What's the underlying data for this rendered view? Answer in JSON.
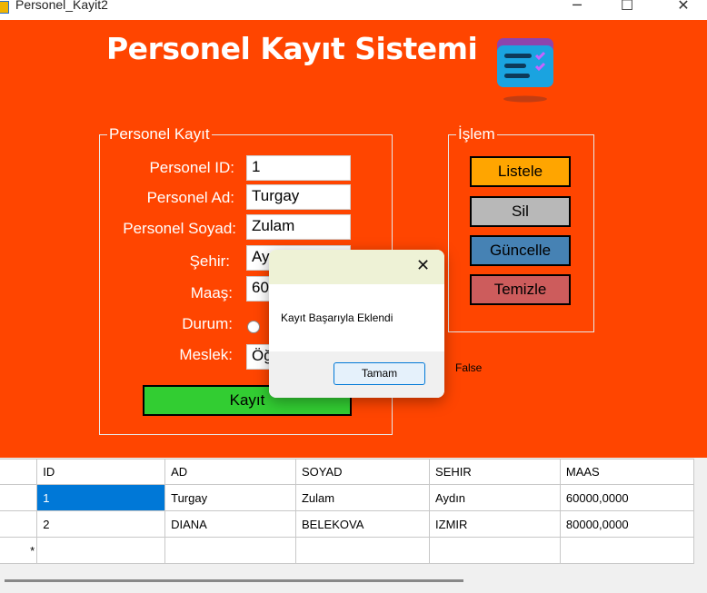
{
  "window": {
    "title": "Personel_Kayit2",
    "minimize_glyph": "─",
    "maximize_glyph": "☐",
    "close_glyph": "✕"
  },
  "app_title": "Personel Kayıt Sistemi",
  "logo_icon": "task-list-icon",
  "form": {
    "group_title": "Personel Kayıt",
    "id_label": "Personel ID:",
    "id_value": "1",
    "ad_label": "Personel Ad:",
    "ad_value": "Turgay",
    "soyad_label": "Personel Soyad:",
    "soyad_value": "Zulam",
    "sehir_label": "Şehir:",
    "sehir_value": "Ay",
    "maas_label": "Maaş:",
    "maas_value": "60",
    "durum_label": "Durum:",
    "meslek_label": "Meslek:",
    "meslek_value": "Öğ",
    "kayit_button": "Kayıt"
  },
  "actions": {
    "group_title": "İşlem",
    "listele": "Listele",
    "sil": "Sil",
    "guncelle": "Güncelle",
    "temizle": "Temizle"
  },
  "status_text": "False",
  "dialog": {
    "message": "Kayıt Başarıyla Eklendi",
    "ok_button": "Tamam",
    "close_glyph": "✕"
  },
  "grid": {
    "columns": [
      "ID",
      "AD",
      "SOYAD",
      "SEHIR",
      "MAAS"
    ],
    "rows": [
      [
        "1",
        "Turgay",
        "Zulam",
        "Aydın",
        "60000,0000"
      ],
      [
        "2",
        "DIANA",
        "BELEKOVA",
        "IZMIR",
        "80000,0000"
      ]
    ],
    "new_row_marker": "*"
  },
  "colors": {
    "background": "#ff4500",
    "listele": "#ffa500",
    "sil": "#b8b8b8",
    "guncelle": "#4682b4",
    "temizle": "#cd5c5c",
    "kayit": "#32cd32",
    "selected_cell": "#0078d7"
  }
}
